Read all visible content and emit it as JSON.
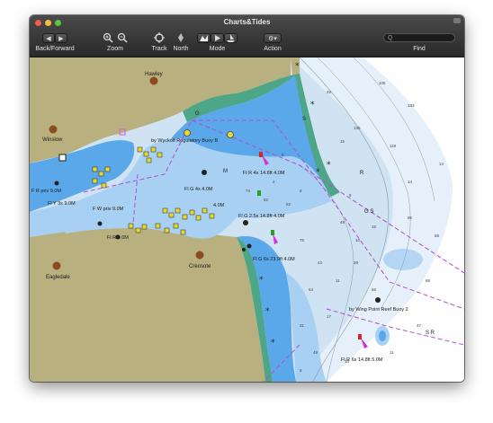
{
  "window": {
    "title": "Charts&Tides"
  },
  "toolbar": {
    "back_forward_label": "Back/Forward",
    "zoom_label": "Zoom",
    "track_label": "Track",
    "north_label": "North",
    "mode_label": "Mode",
    "action_label": "Action",
    "find_label": "Find",
    "search_placeholder": "Q",
    "icons": [
      "chevron-left-icon",
      "chevron-right-icon",
      "zoom-in-icon",
      "zoom-out-icon",
      "track-icon",
      "north-icon",
      "mode-chart-icon",
      "mode-play-icon",
      "mode-boat-icon",
      "gear-icon"
    ]
  },
  "map": {
    "places": {
      "hawley": "Hawley",
      "winslow": "Winslow",
      "eagledale": "Eagledale",
      "creosote": "Creosote"
    },
    "buoys": {
      "wyckoff": "by Wyckoff Regulatory Buoy B",
      "wing_point": "by Wing Point Reef Buoy 2"
    },
    "lights": {
      "fr_4s": "Fl R 4s 14.6ft 4.0M",
      "fr_priv": "F R priv 9.0M",
      "fy_3s": "Fl Y 3s 9.0M",
      "fw_priv": "F W priv 9.0M",
      "fg_4s": "Fl G 4s 4.0M",
      "fg_2_5s": "Fl G 2.5s 14.8ft 4.0M",
      "fr_4": "Fl R 4.0M",
      "fl_g_6s": "Fl G 6s 23.9ft 4.0M",
      "flr_6s": "Fl R 6s 14.8ft 5.0M",
      "sp_4m": "4.0M"
    },
    "marks": {
      "m": "M",
      "s": "S",
      "g": "G",
      "r": "R",
      "sr": "S R",
      "gs": "G S"
    },
    "depths": [
      "105",
      "183",
      "135",
      "119",
      "15",
      "49",
      "8",
      "92",
      "48",
      "10",
      "75",
      "43",
      "11",
      "54",
      "17",
      "39",
      "15",
      "14",
      "68",
      "88",
      "31",
      "48",
      "10",
      "74",
      "82",
      "95",
      "11",
      "6",
      "9",
      "14",
      "47",
      "56",
      "4",
      "5"
    ],
    "colors": {
      "land": "#b8b07e",
      "deep": "#ffffff",
      "mid": "#d3e6f6",
      "shallow": "#a8d0f2",
      "veryshallow": "#5aa8ea",
      "intertidal": "#4ea689",
      "route": "#b04ed0",
      "mark_yellow": "#e5d830"
    }
  }
}
